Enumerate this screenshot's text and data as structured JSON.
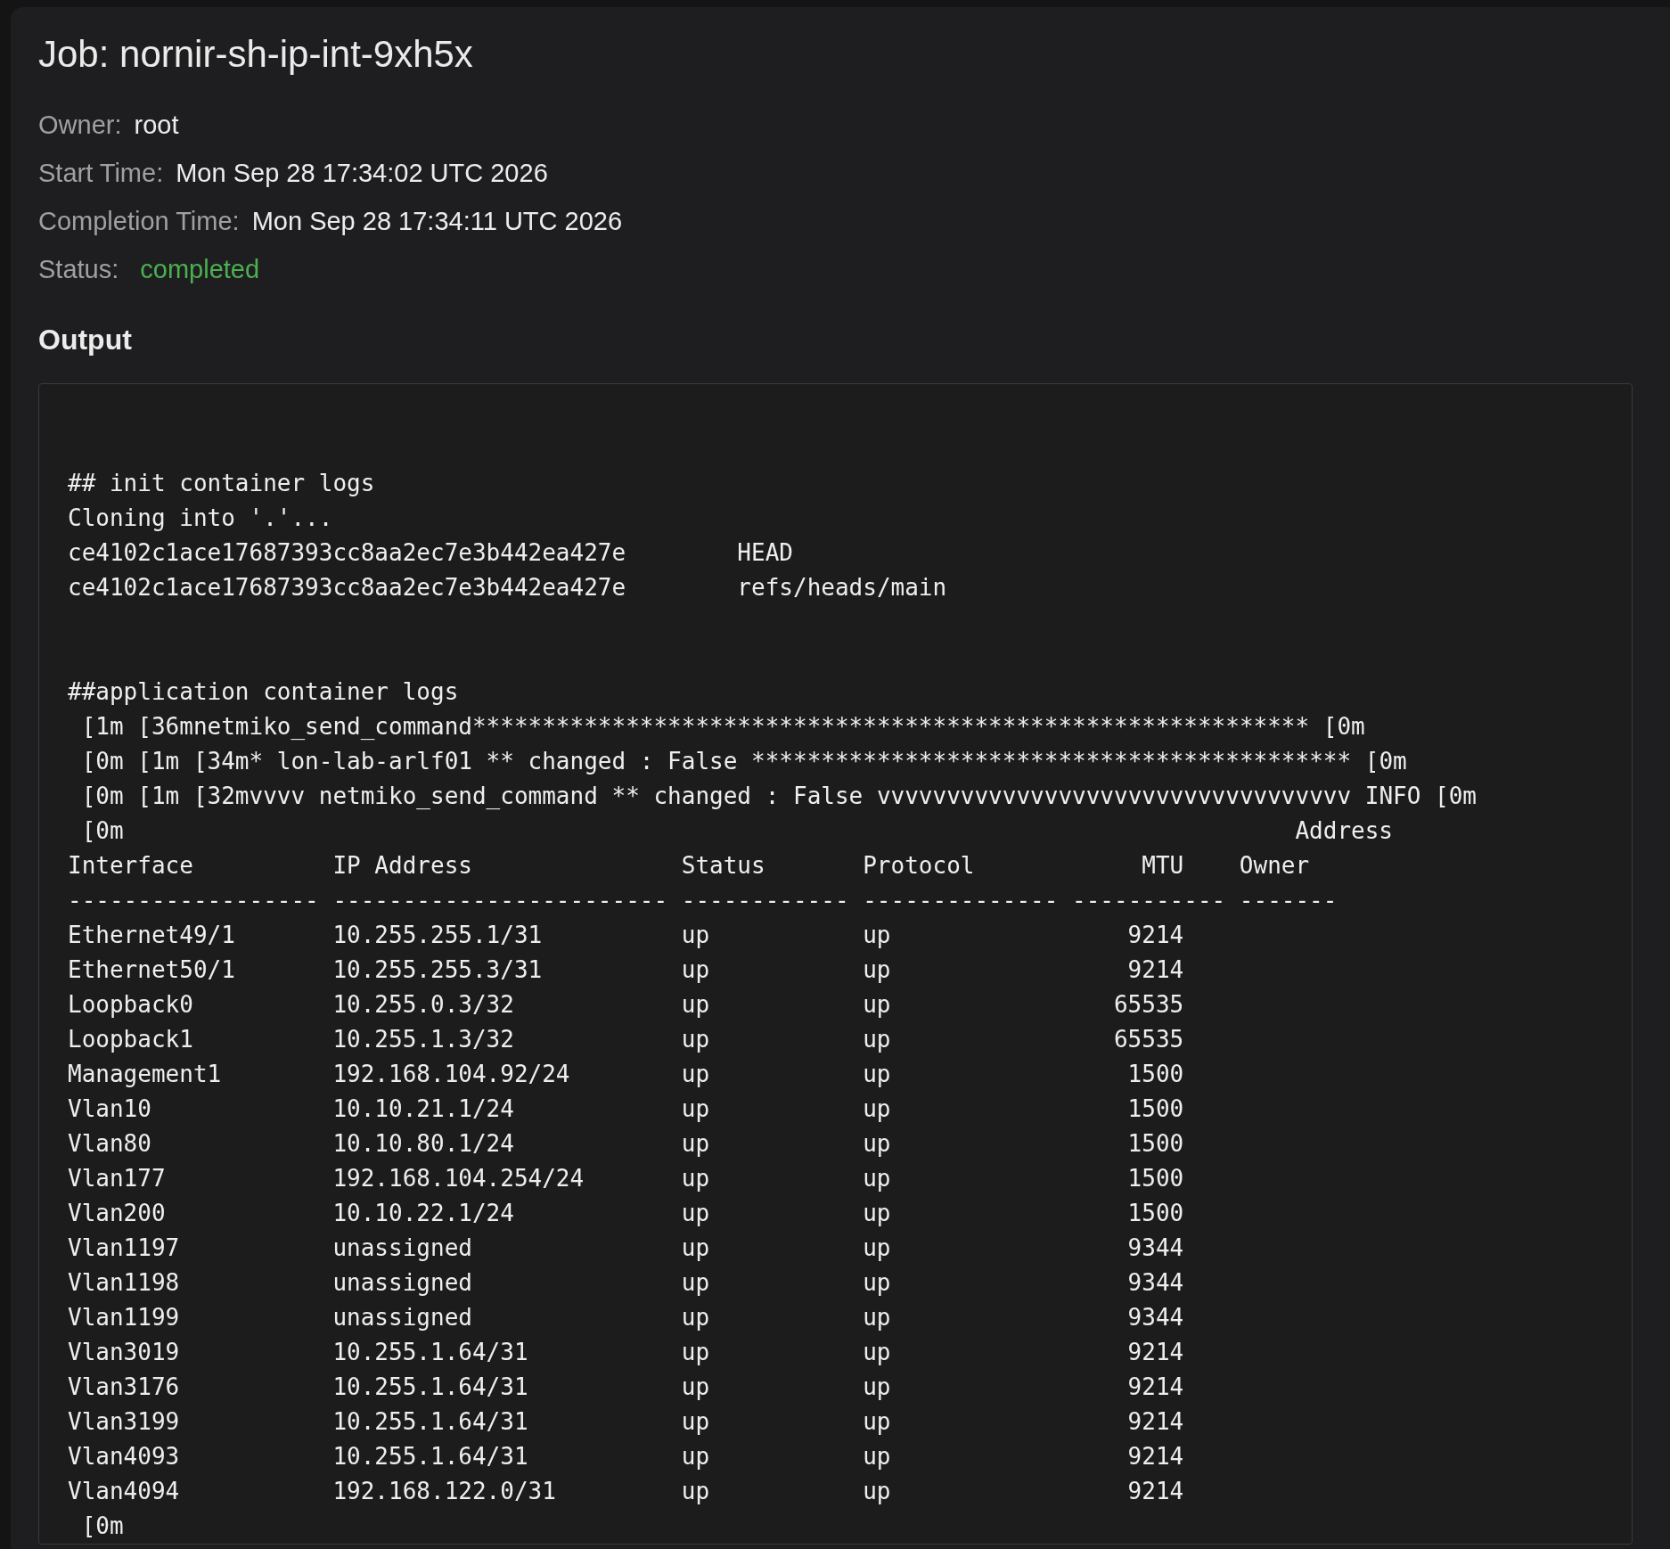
{
  "title": "Job: nornir-sh-ip-int-9xh5x",
  "fields": [
    {
      "label": "Owner:",
      "value": "root",
      "kind": "plain"
    },
    {
      "label": "Start Time:",
      "value": "Mon Sep 28 17:34:02 UTC 2026",
      "kind": "plain"
    },
    {
      "label": "Completion Time:",
      "value": "Mon Sep 28 17:34:11 UTC 2026",
      "kind": "plain"
    },
    {
      "label": "Status:",
      "value": "completed",
      "kind": "status"
    }
  ],
  "output": {
    "heading": "Output",
    "sections": [
      {
        "lines": [
          {
            "kind": "text",
            "text": "## init container logs"
          },
          {
            "kind": "text",
            "text": "Cloning into '.'..."
          },
          {
            "kind": "ref",
            "hash": "ce4102c1ace17687393cc8aa2ec7e3b442ea427e",
            "ref": "HEAD"
          },
          {
            "kind": "ref",
            "hash": "ce4102c1ace17687393cc8aa2ec7e3b442ea427e",
            "ref": "refs/heads/main"
          }
        ]
      },
      {
        "lines": [
          {
            "kind": "text",
            "text": "##application container logs"
          },
          {
            "kind": "text",
            "text": " [1m [36mnetmiko_send_command************************************************************ [0m"
          },
          {
            "kind": "text",
            "text": " [0m [1m [34m* lon-lab-arlf01 ** changed : False ******************************************* [0m"
          },
          {
            "kind": "text",
            "text": " [0m [1m [32mvvvv netmiko_send_command ** changed : False vvvvvvvvvvvvvvvvvvvvvvvvvvvvvvvvvv INFO [0m"
          }
        ]
      }
    ],
    "table": {
      "lead_in": " [0m",
      "columns": [
        {
          "header": [
            "Interface"
          ],
          "rule": "------------------",
          "kind": "text"
        },
        {
          "header": [
            "IP Address"
          ],
          "rule": "------------------------",
          "kind": "text"
        },
        {
          "header": [
            "Status"
          ],
          "rule": "------------",
          "kind": "text"
        },
        {
          "header": [
            "Protocol"
          ],
          "rule": "--------------",
          "kind": "text"
        },
        {
          "header": [
            "MTU"
          ],
          "rule": "-----------",
          "kind": "number"
        },
        {
          "header": [
            "Address",
            "Owner"
          ],
          "rule": "-------",
          "kind": "text"
        }
      ],
      "rows": [
        [
          "Ethernet49/1",
          "10.255.255.1/31",
          "up",
          "up",
          "9214"
        ],
        [
          "Ethernet50/1",
          "10.255.255.3/31",
          "up",
          "up",
          "9214"
        ],
        [
          "Loopback0",
          "10.255.0.3/32",
          "up",
          "up",
          "65535"
        ],
        [
          "Loopback1",
          "10.255.1.3/32",
          "up",
          "up",
          "65535"
        ],
        [
          "Management1",
          "192.168.104.92/24",
          "up",
          "up",
          "1500"
        ],
        [
          "Vlan10",
          "10.10.21.1/24",
          "up",
          "up",
          "1500"
        ],
        [
          "Vlan80",
          "10.10.80.1/24",
          "up",
          "up",
          "1500"
        ],
        [
          "Vlan177",
          "192.168.104.254/24",
          "up",
          "up",
          "1500"
        ],
        [
          "Vlan200",
          "10.10.22.1/24",
          "up",
          "up",
          "1500"
        ],
        [
          "Vlan1197",
          "unassigned",
          "up",
          "up",
          "9344"
        ],
        [
          "Vlan1198",
          "unassigned",
          "up",
          "up",
          "9344"
        ],
        [
          "Vlan1199",
          "unassigned",
          "up",
          "up",
          "9344"
        ],
        [
          "Vlan3019",
          "10.255.1.64/31",
          "up",
          "up",
          "9214"
        ],
        [
          "Vlan3176",
          "10.255.1.64/31",
          "up",
          "up",
          "9214"
        ],
        [
          "Vlan3199",
          "10.255.1.64/31",
          "up",
          "up",
          "9214"
        ],
        [
          "Vlan4093",
          "10.255.1.64/31",
          "up",
          "up",
          "9214"
        ],
        [
          "Vlan4094",
          "192.168.122.0/31",
          "up",
          "up",
          "9214"
        ]
      ],
      "trailer": " [0m"
    }
  }
}
